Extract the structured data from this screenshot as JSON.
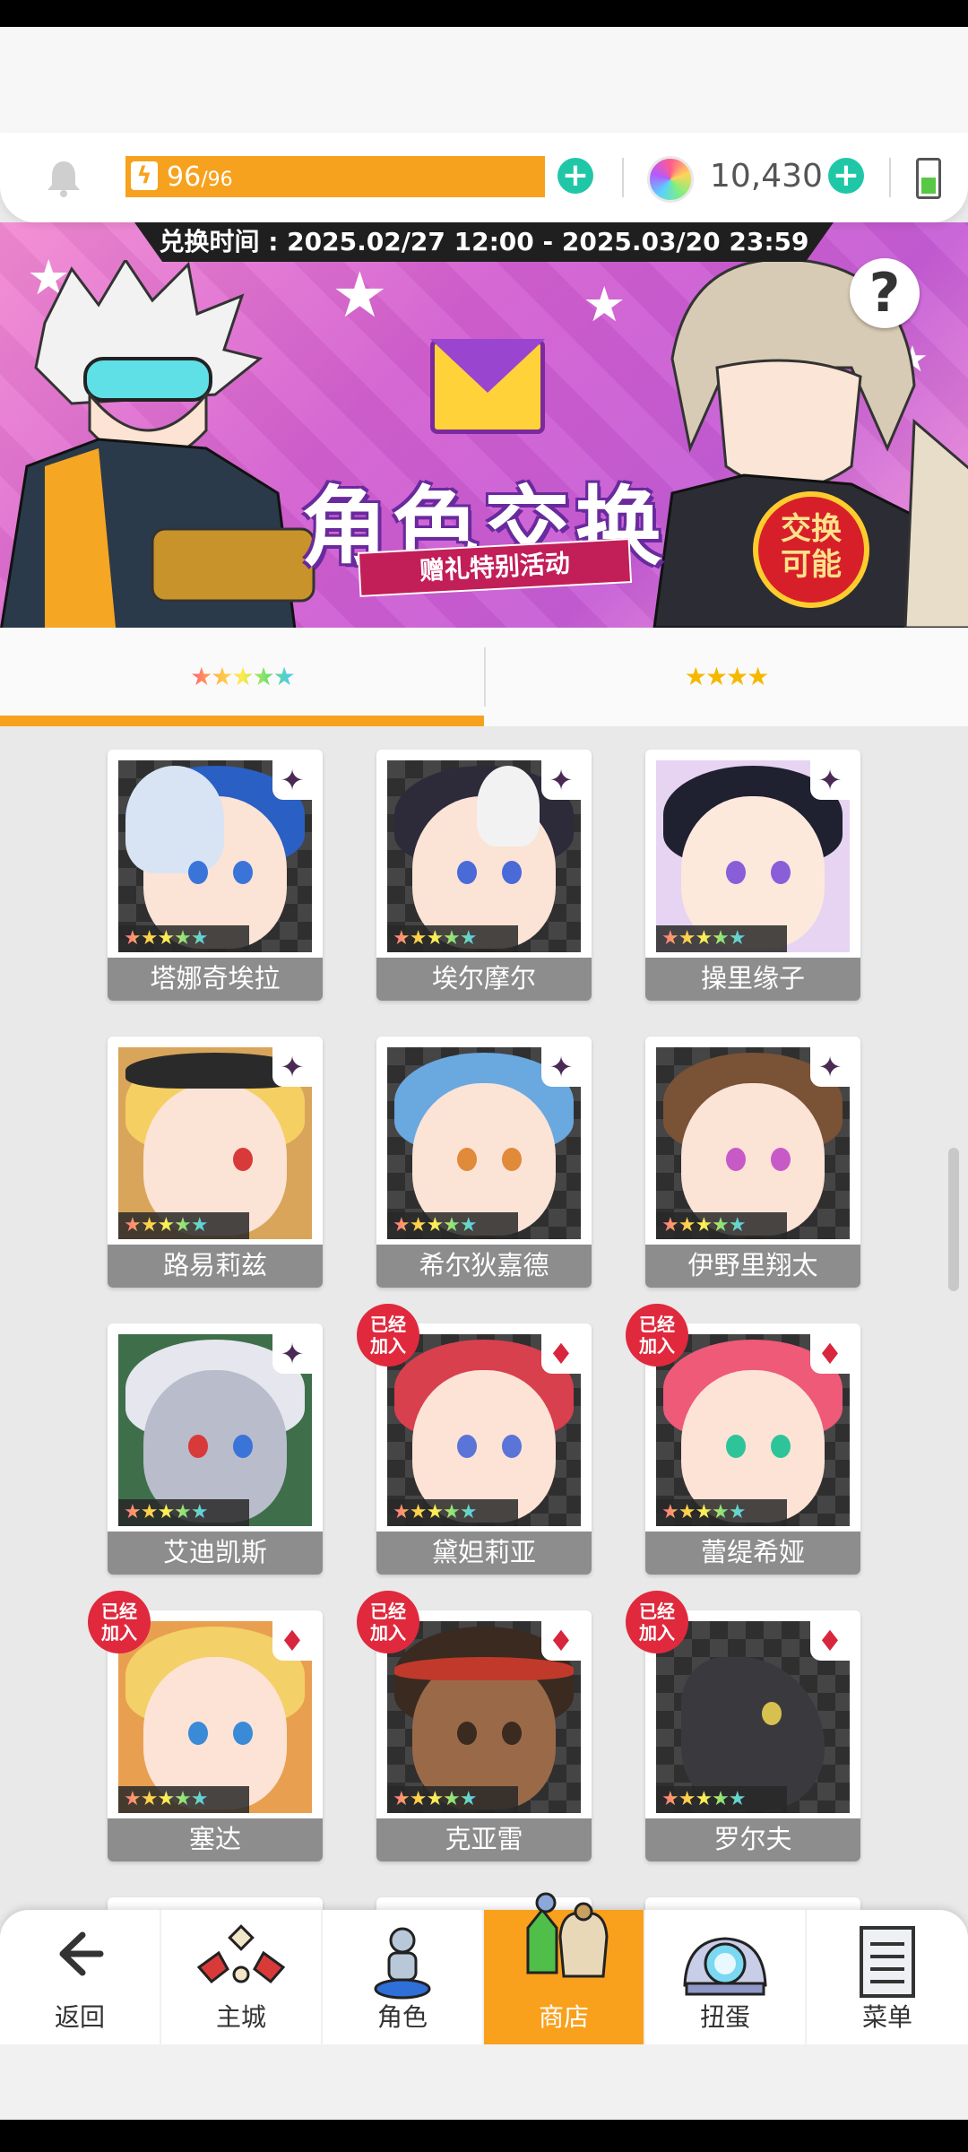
{
  "resources": {
    "energy_current": "96",
    "energy_max": "/96",
    "energy_fraction": 1.0,
    "gems": "10,430"
  },
  "banner": {
    "exchange_time": "兑换时间 : 2025.02/27 12:00 - 2025.03/20 23:59",
    "title": "角色交换",
    "subtitle": "赠礼特别活动",
    "badge_line1": "交换",
    "badge_line2": "可能"
  },
  "tabs": [
    {
      "label": "★★★★★",
      "active": true
    },
    {
      "label": "★★★★",
      "active": false
    }
  ],
  "card_stars": "★★★★★",
  "joined_label_1": "已经",
  "joined_label_2": "加入",
  "characters": [
    {
      "name": "塔娜奇埃拉"
    },
    {
      "name": "埃尔摩尔"
    },
    {
      "name": "操里缘子"
    },
    {
      "name": "路易莉兹"
    },
    {
      "name": "希尔狄嘉德"
    },
    {
      "name": "伊野里翔太"
    },
    {
      "name": "艾迪凯斯"
    },
    {
      "name": "黛妲莉亚"
    },
    {
      "name": "蕾缇希娅"
    },
    {
      "name": "塞达"
    },
    {
      "name": "克亚雷"
    },
    {
      "name": "罗尔夫"
    }
  ],
  "nav": [
    {
      "label": "返回"
    },
    {
      "label": "主城"
    },
    {
      "label": "角色"
    },
    {
      "label": "商店"
    },
    {
      "label": "扭蛋"
    },
    {
      "label": "菜单"
    }
  ],
  "colors": {
    "accent": "#f7a21f",
    "plus": "#1fc7a7",
    "joined_badge": "#e0293d"
  }
}
